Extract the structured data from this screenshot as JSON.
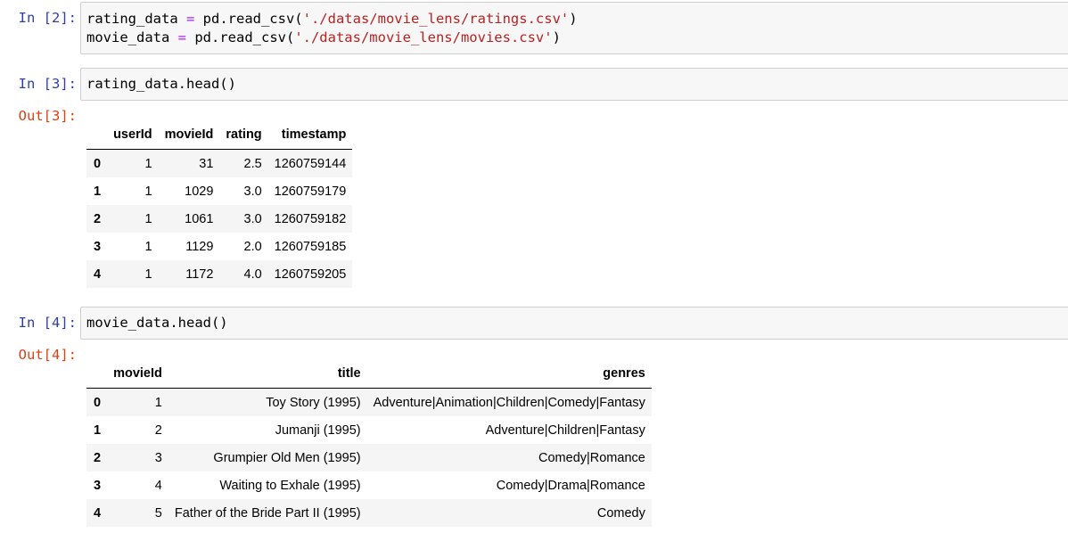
{
  "cells": [
    {
      "prompt": "In [2]:",
      "code_lines": [
        {
          "var": "rating_data",
          "op": " = ",
          "func": "pd.read_csv(",
          "str": "'./datas/movie_lens/ratings.csv'",
          "end": ")"
        },
        {
          "var": "movie_data",
          "op": " = ",
          "func": "pd.read_csv(",
          "str": "'./datas/movie_lens/movies.csv'",
          "end": ")"
        }
      ]
    },
    {
      "prompt": "In [3]:",
      "code": "rating_data.head()",
      "out_prompt": "Out[3]:",
      "table": {
        "columns": [
          "userId",
          "movieId",
          "rating",
          "timestamp"
        ],
        "rows": [
          {
            "index": "0",
            "cells": [
              "1",
              "31",
              "2.5",
              "1260759144"
            ]
          },
          {
            "index": "1",
            "cells": [
              "1",
              "1029",
              "3.0",
              "1260759179"
            ]
          },
          {
            "index": "2",
            "cells": [
              "1",
              "1061",
              "3.0",
              "1260759182"
            ]
          },
          {
            "index": "3",
            "cells": [
              "1",
              "1129",
              "2.0",
              "1260759185"
            ]
          },
          {
            "index": "4",
            "cells": [
              "1",
              "1172",
              "4.0",
              "1260759205"
            ]
          }
        ]
      }
    },
    {
      "prompt": "In [4]:",
      "code": "movie_data.head()",
      "out_prompt": "Out[4]:",
      "table": {
        "columns": [
          "movieId",
          "title",
          "genres"
        ],
        "rows": [
          {
            "index": "0",
            "cells": [
              "1",
              "Toy Story (1995)",
              "Adventure|Animation|Children|Comedy|Fantasy"
            ]
          },
          {
            "index": "1",
            "cells": [
              "2",
              "Jumanji (1995)",
              "Adventure|Children|Fantasy"
            ]
          },
          {
            "index": "2",
            "cells": [
              "3",
              "Grumpier Old Men (1995)",
              "Comedy|Romance"
            ]
          },
          {
            "index": "3",
            "cells": [
              "4",
              "Waiting to Exhale (1995)",
              "Comedy|Drama|Romance"
            ]
          },
          {
            "index": "4",
            "cells": [
              "5",
              "Father of the Bride Part II (1995)",
              "Comedy"
            ]
          }
        ]
      }
    }
  ]
}
